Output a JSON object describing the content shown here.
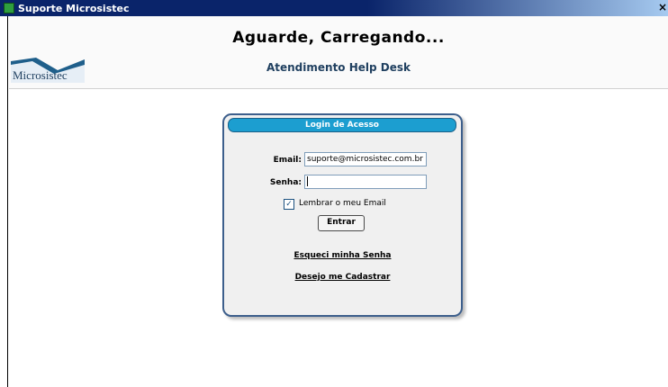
{
  "window": {
    "title": "Suporte Microsistec",
    "close_glyph": "×"
  },
  "header": {
    "loading_text": "Aguarde, Carregando...",
    "logo_text": "Microsistec",
    "help_title": "Atendimento Help Desk"
  },
  "login": {
    "header": "Login de Acesso",
    "email_label": "Email:",
    "email_value": "suporte@microsistec.com.br",
    "password_label": "Senha:",
    "password_value": "",
    "remember_checked": true,
    "remember_label": "Lembrar o meu Email",
    "submit_label": "Entrar",
    "forgot_link": "Esqueci minha Senha",
    "register_link": "Desejo me Cadastrar"
  },
  "colors": {
    "titlebar": "#0a246a",
    "login_header": "#1c9ed0",
    "login_border": "#3d5f8c",
    "help_title": "#1f3f5f"
  },
  "icons": [
    "app-icon",
    "close-icon",
    "checkmark-icon"
  ]
}
